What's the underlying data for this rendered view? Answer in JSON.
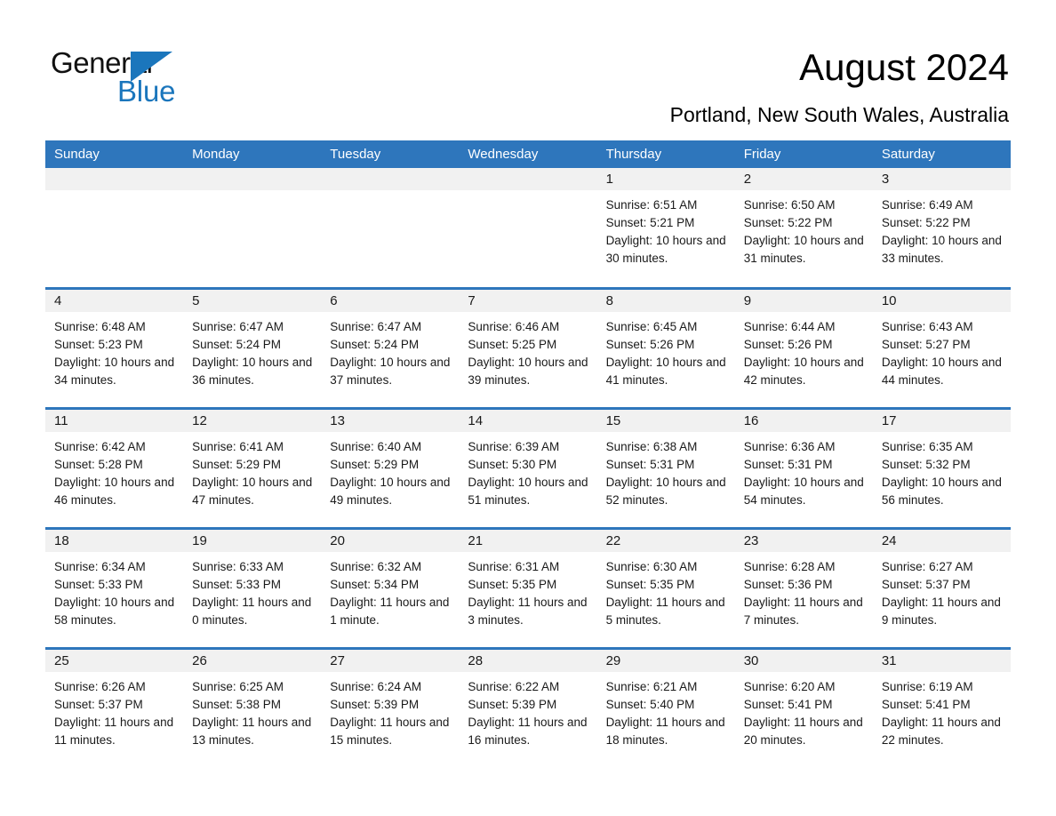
{
  "logo": {
    "word_one": "General",
    "word_two": "Blue",
    "triangle_icon": "blue-triangle-logo-mark",
    "accent_color": "#1b76bc"
  },
  "header": {
    "title": "August 2024",
    "subtitle": "Portland, New South Wales, Australia"
  },
  "colors": {
    "header_blue": "#2e76bc",
    "date_band_gray": "#f1f1f1",
    "text": "#1a1a1a"
  },
  "calendar": {
    "weekday_headers": [
      "Sunday",
      "Monday",
      "Tuesday",
      "Wednesday",
      "Thursday",
      "Friday",
      "Saturday"
    ],
    "weeks": [
      [
        {
          "day": "",
          "sunrise": "",
          "sunset": "",
          "daylight": "",
          "empty": true
        },
        {
          "day": "",
          "sunrise": "",
          "sunset": "",
          "daylight": "",
          "empty": true
        },
        {
          "day": "",
          "sunrise": "",
          "sunset": "",
          "daylight": "",
          "empty": true
        },
        {
          "day": "",
          "sunrise": "",
          "sunset": "",
          "daylight": "",
          "empty": true
        },
        {
          "day": "1",
          "sunrise": "Sunrise: 6:51 AM",
          "sunset": "Sunset: 5:21 PM",
          "daylight": "Daylight: 10 hours and 30 minutes."
        },
        {
          "day": "2",
          "sunrise": "Sunrise: 6:50 AM",
          "sunset": "Sunset: 5:22 PM",
          "daylight": "Daylight: 10 hours and 31 minutes."
        },
        {
          "day": "3",
          "sunrise": "Sunrise: 6:49 AM",
          "sunset": "Sunset: 5:22 PM",
          "daylight": "Daylight: 10 hours and 33 minutes."
        }
      ],
      [
        {
          "day": "4",
          "sunrise": "Sunrise: 6:48 AM",
          "sunset": "Sunset: 5:23 PM",
          "daylight": "Daylight: 10 hours and 34 minutes."
        },
        {
          "day": "5",
          "sunrise": "Sunrise: 6:47 AM",
          "sunset": "Sunset: 5:24 PM",
          "daylight": "Daylight: 10 hours and 36 minutes."
        },
        {
          "day": "6",
          "sunrise": "Sunrise: 6:47 AM",
          "sunset": "Sunset: 5:24 PM",
          "daylight": "Daylight: 10 hours and 37 minutes."
        },
        {
          "day": "7",
          "sunrise": "Sunrise: 6:46 AM",
          "sunset": "Sunset: 5:25 PM",
          "daylight": "Daylight: 10 hours and 39 minutes."
        },
        {
          "day": "8",
          "sunrise": "Sunrise: 6:45 AM",
          "sunset": "Sunset: 5:26 PM",
          "daylight": "Daylight: 10 hours and 41 minutes."
        },
        {
          "day": "9",
          "sunrise": "Sunrise: 6:44 AM",
          "sunset": "Sunset: 5:26 PM",
          "daylight": "Daylight: 10 hours and 42 minutes."
        },
        {
          "day": "10",
          "sunrise": "Sunrise: 6:43 AM",
          "sunset": "Sunset: 5:27 PM",
          "daylight": "Daylight: 10 hours and 44 minutes."
        }
      ],
      [
        {
          "day": "11",
          "sunrise": "Sunrise: 6:42 AM",
          "sunset": "Sunset: 5:28 PM",
          "daylight": "Daylight: 10 hours and 46 minutes."
        },
        {
          "day": "12",
          "sunrise": "Sunrise: 6:41 AM",
          "sunset": "Sunset: 5:29 PM",
          "daylight": "Daylight: 10 hours and 47 minutes."
        },
        {
          "day": "13",
          "sunrise": "Sunrise: 6:40 AM",
          "sunset": "Sunset: 5:29 PM",
          "daylight": "Daylight: 10 hours and 49 minutes."
        },
        {
          "day": "14",
          "sunrise": "Sunrise: 6:39 AM",
          "sunset": "Sunset: 5:30 PM",
          "daylight": "Daylight: 10 hours and 51 minutes."
        },
        {
          "day": "15",
          "sunrise": "Sunrise: 6:38 AM",
          "sunset": "Sunset: 5:31 PM",
          "daylight": "Daylight: 10 hours and 52 minutes."
        },
        {
          "day": "16",
          "sunrise": "Sunrise: 6:36 AM",
          "sunset": "Sunset: 5:31 PM",
          "daylight": "Daylight: 10 hours and 54 minutes."
        },
        {
          "day": "17",
          "sunrise": "Sunrise: 6:35 AM",
          "sunset": "Sunset: 5:32 PM",
          "daylight": "Daylight: 10 hours and 56 minutes."
        }
      ],
      [
        {
          "day": "18",
          "sunrise": "Sunrise: 6:34 AM",
          "sunset": "Sunset: 5:33 PM",
          "daylight": "Daylight: 10 hours and 58 minutes."
        },
        {
          "day": "19",
          "sunrise": "Sunrise: 6:33 AM",
          "sunset": "Sunset: 5:33 PM",
          "daylight": "Daylight: 11 hours and 0 minutes."
        },
        {
          "day": "20",
          "sunrise": "Sunrise: 6:32 AM",
          "sunset": "Sunset: 5:34 PM",
          "daylight": "Daylight: 11 hours and 1 minute."
        },
        {
          "day": "21",
          "sunrise": "Sunrise: 6:31 AM",
          "sunset": "Sunset: 5:35 PM",
          "daylight": "Daylight: 11 hours and 3 minutes."
        },
        {
          "day": "22",
          "sunrise": "Sunrise: 6:30 AM",
          "sunset": "Sunset: 5:35 PM",
          "daylight": "Daylight: 11 hours and 5 minutes."
        },
        {
          "day": "23",
          "sunrise": "Sunrise: 6:28 AM",
          "sunset": "Sunset: 5:36 PM",
          "daylight": "Daylight: 11 hours and 7 minutes."
        },
        {
          "day": "24",
          "sunrise": "Sunrise: 6:27 AM",
          "sunset": "Sunset: 5:37 PM",
          "daylight": "Daylight: 11 hours and 9 minutes."
        }
      ],
      [
        {
          "day": "25",
          "sunrise": "Sunrise: 6:26 AM",
          "sunset": "Sunset: 5:37 PM",
          "daylight": "Daylight: 11 hours and 11 minutes."
        },
        {
          "day": "26",
          "sunrise": "Sunrise: 6:25 AM",
          "sunset": "Sunset: 5:38 PM",
          "daylight": "Daylight: 11 hours and 13 minutes."
        },
        {
          "day": "27",
          "sunrise": "Sunrise: 6:24 AM",
          "sunset": "Sunset: 5:39 PM",
          "daylight": "Daylight: 11 hours and 15 minutes."
        },
        {
          "day": "28",
          "sunrise": "Sunrise: 6:22 AM",
          "sunset": "Sunset: 5:39 PM",
          "daylight": "Daylight: 11 hours and 16 minutes."
        },
        {
          "day": "29",
          "sunrise": "Sunrise: 6:21 AM",
          "sunset": "Sunset: 5:40 PM",
          "daylight": "Daylight: 11 hours and 18 minutes."
        },
        {
          "day": "30",
          "sunrise": "Sunrise: 6:20 AM",
          "sunset": "Sunset: 5:41 PM",
          "daylight": "Daylight: 11 hours and 20 minutes."
        },
        {
          "day": "31",
          "sunrise": "Sunrise: 6:19 AM",
          "sunset": "Sunset: 5:41 PM",
          "daylight": "Daylight: 11 hours and 22 minutes."
        }
      ]
    ]
  }
}
